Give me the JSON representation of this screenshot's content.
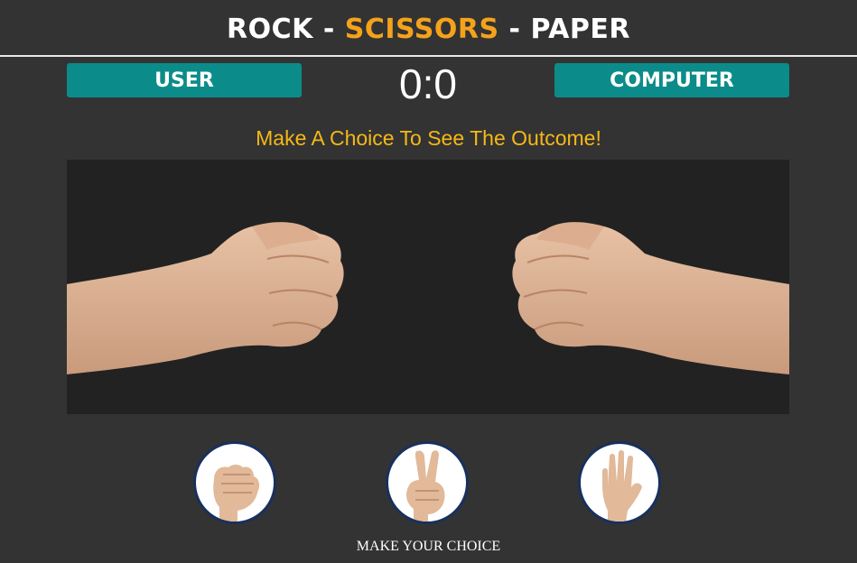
{
  "header": {
    "title_part1": "ROCK - ",
    "title_accent": "SCISSORS",
    "title_part3": " - PAPER"
  },
  "scoreboard": {
    "user_label": "USER",
    "computer_label": "COMPUTER",
    "score": "0:0"
  },
  "message": "Make A Choice To See The Outcome!",
  "arena": {
    "user_hand": "rock-fist-icon",
    "computer_hand": "rock-fist-icon"
  },
  "choices": [
    {
      "name": "rock",
      "icon": "rock-hand-icon"
    },
    {
      "name": "scissors",
      "icon": "scissors-hand-icon"
    },
    {
      "name": "paper",
      "icon": "paper-hand-icon"
    }
  ],
  "prompt": "MAKE YOUR CHOICE",
  "colors": {
    "background": "#333333",
    "arena": "#222222",
    "badge": "#0b8c8a",
    "accent": "#f5a21b",
    "message": "#f5b816",
    "choice_border": "#17305e"
  }
}
